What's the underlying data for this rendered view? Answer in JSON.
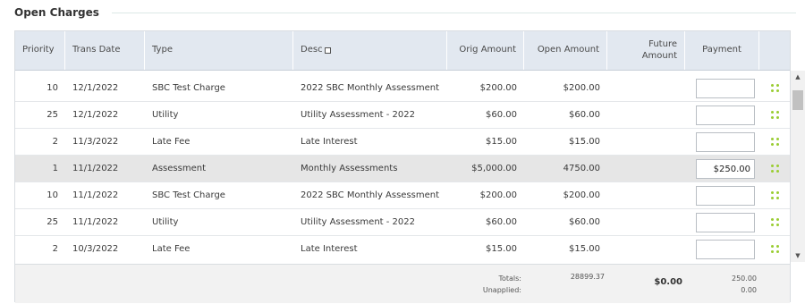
{
  "section": {
    "title": "Open Charges"
  },
  "columns": {
    "priority": "Priority",
    "trans_date": "Trans Date",
    "type": "Type",
    "desc": "Desc",
    "orig_amount": "Orig Amount",
    "open_amount": "Open Amount",
    "future_amount": "Future Amount",
    "payment": "Payment"
  },
  "rows": [
    {
      "priority": "10",
      "trans_date": "12/1/2022",
      "type": "SBC Test Charge",
      "desc": "2022 SBC Monthly Assessment",
      "orig_amount": "$200.00",
      "open_amount": "$200.00",
      "future_amount": "",
      "payment": "",
      "selected": false
    },
    {
      "priority": "25",
      "trans_date": "12/1/2022",
      "type": "Utility",
      "desc": "Utility Assessment - 2022",
      "orig_amount": "$60.00",
      "open_amount": "$60.00",
      "future_amount": "",
      "payment": "",
      "selected": false
    },
    {
      "priority": "2",
      "trans_date": "11/3/2022",
      "type": "Late Fee",
      "desc": "Late Interest",
      "orig_amount": "$15.00",
      "open_amount": "$15.00",
      "future_amount": "",
      "payment": "",
      "selected": false
    },
    {
      "priority": "1",
      "trans_date": "11/1/2022",
      "type": "Assessment",
      "desc": "Monthly Assessments",
      "orig_amount": "$5,000.00",
      "open_amount": "4750.00",
      "future_amount": "",
      "payment": "$250.00",
      "selected": true
    },
    {
      "priority": "10",
      "trans_date": "11/1/2022",
      "type": "SBC Test Charge",
      "desc": "2022 SBC Monthly Assessment",
      "orig_amount": "$200.00",
      "open_amount": "$200.00",
      "future_amount": "",
      "payment": "",
      "selected": false
    },
    {
      "priority": "25",
      "trans_date": "11/1/2022",
      "type": "Utility",
      "desc": "Utility Assessment - 2022",
      "orig_amount": "$60.00",
      "open_amount": "$60.00",
      "future_amount": "",
      "payment": "",
      "selected": false
    },
    {
      "priority": "2",
      "trans_date": "10/3/2022",
      "type": "Late Fee",
      "desc": "Late Interest",
      "orig_amount": "$15.00",
      "open_amount": "$15.00",
      "future_amount": "",
      "payment": "",
      "selected": false
    }
  ],
  "footer": {
    "totals_label": "Totals:",
    "unapplied_label": "Unapplied:",
    "open_total": "28899.37",
    "future_total": "$0.00",
    "payment_total": "250.00",
    "unapplied_total": "0.00"
  },
  "icons": {
    "drag_handle": "drag-handle-icon",
    "scroll_up": "scroll-up-arrow-icon",
    "scroll_down": "scroll-down-arrow-icon",
    "desc_checkbox": "checkbox-icon"
  },
  "colors": {
    "header_bg": "#e2e8f0",
    "selected_row_bg": "#e6e6e6",
    "drag_icon": "#9acd32",
    "footer_bg": "#f2f2f2"
  }
}
